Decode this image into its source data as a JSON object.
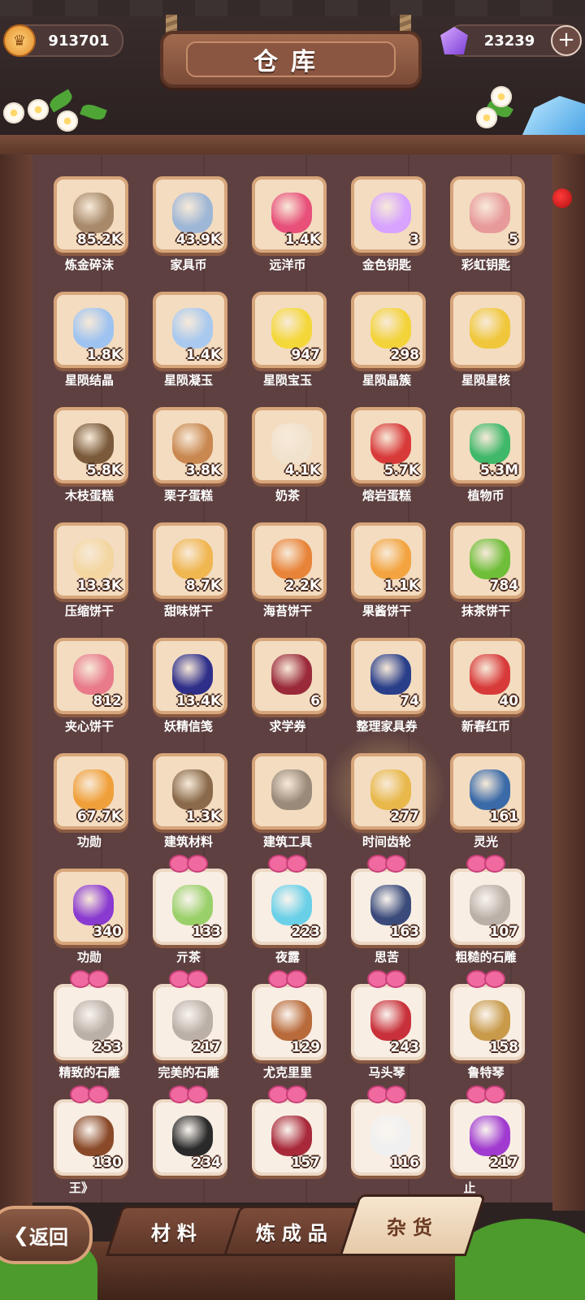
{
  "header": {
    "title": "仓库",
    "gold": "913701",
    "gems": "23239",
    "add_icon": "plus-icon"
  },
  "items": [
    {
      "name": "炼金碎沫",
      "qty": "85.2K",
      "color": "#a88a6a",
      "icon": "rock-icon",
      "ribbon": false
    },
    {
      "name": "家具币",
      "qty": "43.9K",
      "color": "#9fb7d6",
      "icon": "furniture-coin-icon",
      "ribbon": false
    },
    {
      "name": "远洋币",
      "qty": "1.4K",
      "color": "#e8507a",
      "icon": "ocean-coin-icon",
      "ribbon": false
    },
    {
      "name": "金色钥匙",
      "qty": "3",
      "color": "#d7a3ff",
      "icon": "gold-key-icon",
      "ribbon": false
    },
    {
      "name": "彩虹钥匙",
      "qty": "5",
      "color": "#e89a9a",
      "icon": "rainbow-key-icon",
      "ribbon": false
    },
    {
      "name": "星陨结晶",
      "qty": "1.8K",
      "color": "#9fc3f0",
      "icon": "crystal-icon",
      "ribbon": false
    },
    {
      "name": "星陨凝玉",
      "qty": "1.4K",
      "color": "#a9c9ef",
      "icon": "star-jade-icon",
      "ribbon": false
    },
    {
      "name": "星陨宝玉",
      "qty": "947",
      "color": "#f4d83a",
      "icon": "yellow-gem-icon",
      "ribbon": false
    },
    {
      "name": "星陨晶簇",
      "qty": "298",
      "color": "#f3d33a",
      "icon": "star-cluster-icon",
      "ribbon": false
    },
    {
      "name": "星陨星核",
      "qty": "",
      "color": "#f0c73a",
      "icon": "star-core-icon",
      "ribbon": false
    },
    {
      "name": "木枝蛋糕",
      "qty": "5.8K",
      "color": "#7a5a3a",
      "icon": "log-cake-icon",
      "ribbon": false
    },
    {
      "name": "栗子蛋糕",
      "qty": "3.8K",
      "color": "#c98850",
      "icon": "chestnut-cake-icon",
      "ribbon": false
    },
    {
      "name": "奶茶",
      "qty": "4.1K",
      "color": "#f0e2cc",
      "icon": "milk-tea-icon",
      "ribbon": false
    },
    {
      "name": "熔岩蛋糕",
      "qty": "5.7K",
      "color": "#d83a3a",
      "icon": "lava-cake-icon",
      "ribbon": false
    },
    {
      "name": "植物币",
      "qty": "5.3M",
      "color": "#3fb86a",
      "icon": "plant-coin-icon",
      "ribbon": false
    },
    {
      "name": "压缩饼干",
      "qty": "13.3K",
      "color": "#f3d6a0",
      "icon": "compressed-biscuit-icon",
      "ribbon": false
    },
    {
      "name": "甜味饼干",
      "qty": "8.7K",
      "color": "#f0b650",
      "icon": "sweet-biscuit-icon",
      "ribbon": false
    },
    {
      "name": "海苔饼干",
      "qty": "2.2K",
      "color": "#e8843a",
      "icon": "seaweed-biscuit-icon",
      "ribbon": false
    },
    {
      "name": "果酱饼干",
      "qty": "1.1K",
      "color": "#f3a440",
      "icon": "jam-biscuit-icon",
      "ribbon": false
    },
    {
      "name": "抹茶饼干",
      "qty": "784",
      "color": "#6fbe3a",
      "icon": "matcha-biscuit-icon",
      "ribbon": false
    },
    {
      "name": "夹心饼干",
      "qty": "812",
      "color": "#e87a8a",
      "icon": "sandwich-cookie-icon",
      "ribbon": false
    },
    {
      "name": "妖精信笺",
      "qty": "13.4K",
      "color": "#2f2f8a",
      "icon": "fairy-letter-icon",
      "ribbon": false
    },
    {
      "name": "求学券",
      "qty": "6",
      "color": "#9a2a3a",
      "icon": "study-ticket-icon",
      "ribbon": false
    },
    {
      "name": "整理家具券",
      "qty": "74",
      "color": "#2a3f8a",
      "icon": "furniture-ticket-icon",
      "ribbon": false
    },
    {
      "name": "新春红币",
      "qty": "40",
      "color": "#d83a3a",
      "icon": "red-coin-icon",
      "ribbon": false
    },
    {
      "name": "功勋",
      "qty": "67.7K",
      "color": "#f0a03a",
      "icon": "star-medal-icon",
      "ribbon": false
    },
    {
      "name": "建筑材料",
      "qty": "1.3K",
      "color": "#8a6a4a",
      "icon": "building-material-icon",
      "ribbon": false
    },
    {
      "name": "建筑工具",
      "qty": "",
      "color": "#9a8a7a",
      "icon": "hammer-icon",
      "ribbon": false
    },
    {
      "name": "时间齿轮",
      "qty": "277",
      "color": "#e8b84a",
      "icon": "gear-icon",
      "ribbon": false,
      "glow": true
    },
    {
      "name": "灵光",
      "qty": "161",
      "color": "#3a6aa8",
      "icon": "spirit-light-icon",
      "ribbon": false
    },
    {
      "name": "功勋",
      "qty": "340",
      "color": "#8a3ad0",
      "icon": "purple-medal-icon",
      "ribbon": false
    },
    {
      "name": "亓茶",
      "qty": "133",
      "color": "#9ad06a",
      "icon": "tea-bowl-icon",
      "ribbon": true
    },
    {
      "name": "夜露",
      "qty": "223",
      "color": "#6ad0e8",
      "icon": "dew-bowl-icon",
      "ribbon": true
    },
    {
      "name": "思苦",
      "qty": "163",
      "color": "#3a4a7a",
      "icon": "bitter-cup-icon",
      "ribbon": true
    },
    {
      "name": "粗糙的石雕",
      "qty": "107",
      "color": "#bab0a8",
      "icon": "rough-statue-icon",
      "ribbon": true
    },
    {
      "name": "精致的石雕",
      "qty": "253",
      "color": "#bab0a8",
      "icon": "bird-statue-icon",
      "ribbon": true
    },
    {
      "name": "完美的石雕",
      "qty": "217",
      "color": "#bab0a8",
      "icon": "bust-statue-icon",
      "ribbon": true
    },
    {
      "name": "尤克里里",
      "qty": "129",
      "color": "#b86a3a",
      "icon": "ukulele-icon",
      "ribbon": true
    },
    {
      "name": "马头琴",
      "qty": "243",
      "color": "#c8303a",
      "icon": "morin-khuur-icon",
      "ribbon": true
    },
    {
      "name": "鲁特琴",
      "qty": "158",
      "color": "#c89a4a",
      "icon": "lute-icon",
      "ribbon": true
    },
    {
      "name": "",
      "qty": "130",
      "color": "#8a4a2a",
      "icon": "brown-book-icon",
      "ribbon": true
    },
    {
      "name": "",
      "qty": "234",
      "color": "#2a2a2a",
      "icon": "black-book-icon",
      "ribbon": true
    },
    {
      "name": "",
      "qty": "157",
      "color": "#a82a3a",
      "icon": "red-book-icon",
      "ribbon": true
    },
    {
      "name": "",
      "qty": "116",
      "color": "#f0f0f0",
      "icon": "milk-bottle-icon",
      "ribbon": true
    },
    {
      "name": "",
      "qty": "217",
      "color": "#a03ad0",
      "icon": "potion-icon",
      "ribbon": true
    }
  ],
  "partial_labels": {
    "row9_col1": "王》",
    "row9_col5": "止"
  },
  "tabs": [
    {
      "label": "材料",
      "active": false
    },
    {
      "label": "炼成品",
      "active": false
    },
    {
      "label": "杂货",
      "active": true
    }
  ],
  "back_button": {
    "label": "返回",
    "icon": "chevron-left-icon"
  }
}
